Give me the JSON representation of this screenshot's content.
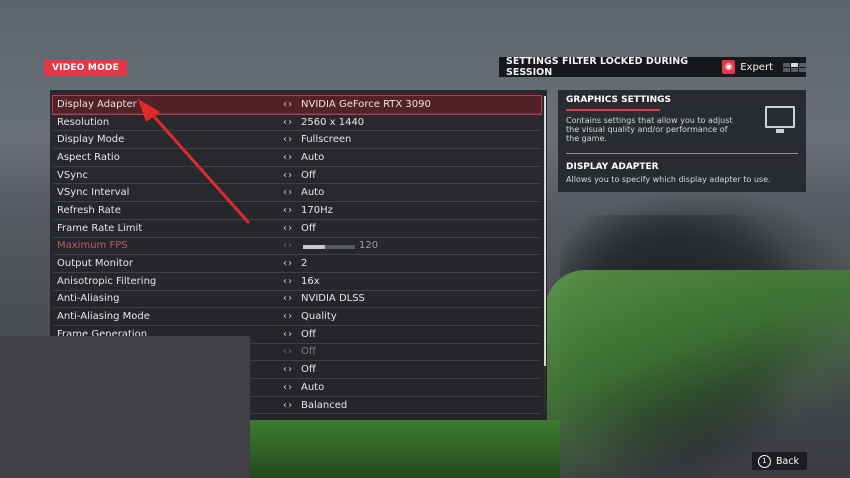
{
  "header": {
    "mode_badge": "VIDEO MODE",
    "filter_text": "SETTINGS FILTER LOCKED DURING SESSION",
    "filter_value": "Expert",
    "lock_icon": "lock-icon",
    "accent_color": "#e4384a"
  },
  "settings": [
    {
      "label": "Display Adapter",
      "value": "NVIDIA GeForce RTX 3090",
      "state": "selected"
    },
    {
      "label": "Resolution",
      "value": "2560 x 1440",
      "state": "normal"
    },
    {
      "label": "Display Mode",
      "value": "Fullscreen",
      "state": "normal"
    },
    {
      "label": "Aspect Ratio",
      "value": "Auto",
      "state": "normal"
    },
    {
      "label": "VSync",
      "value": "Off",
      "state": "normal"
    },
    {
      "label": "VSync Interval",
      "value": "Auto",
      "state": "normal"
    },
    {
      "label": "Refresh Rate",
      "value": "170Hz",
      "state": "normal"
    },
    {
      "label": "Frame Rate Limit",
      "value": "Off",
      "state": "normal"
    },
    {
      "label": "Maximum FPS",
      "value": "120",
      "state": "disabled",
      "slider_fraction": 0.42
    },
    {
      "label": "Output Monitor",
      "value": "2",
      "state": "normal"
    },
    {
      "label": "Anisotropic Filtering",
      "value": "16x",
      "state": "normal"
    },
    {
      "label": "Anti-Aliasing",
      "value": "NVIDIA DLSS",
      "state": "normal"
    },
    {
      "label": "Anti-Aliasing Mode",
      "value": "Quality",
      "state": "normal"
    },
    {
      "label": "Frame Generation",
      "value": "Off",
      "state": "normal"
    },
    {
      "label": "",
      "value": "Off",
      "state": "dim"
    },
    {
      "label": "",
      "value": "Off",
      "state": "normal"
    },
    {
      "label": "",
      "value": "Auto",
      "state": "normal"
    },
    {
      "label": "",
      "value": "Balanced",
      "state": "normal"
    }
  ],
  "info": {
    "section_title": "GRAPHICS SETTINGS",
    "section_text": "Contains settings that allow you to adjust the visual quality and/or performance of the game.",
    "item_title": "DISPLAY ADAPTER",
    "item_text": "Allows you to specify which display adapter to use."
  },
  "footer": {
    "back_label": "Back",
    "back_key": "1"
  }
}
